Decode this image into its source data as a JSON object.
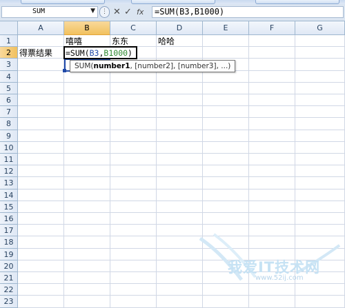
{
  "name_box": {
    "value": "SUM"
  },
  "formula_bar": {
    "cancel_glyph": "✕",
    "enter_glyph": "✓",
    "fx_label": "fx",
    "value": "=SUM(B3,B1000)"
  },
  "columns": [
    "A",
    "B",
    "C",
    "D",
    "E",
    "F",
    "G"
  ],
  "active_column": "B",
  "rows": [
    "1",
    "2",
    "3",
    "4",
    "5",
    "6",
    "7",
    "8",
    "9",
    "10",
    "11",
    "12",
    "13",
    "14",
    "15",
    "16",
    "17",
    "18",
    "19",
    "20",
    "21",
    "22",
    "23"
  ],
  "active_row": "2",
  "cells": {
    "B1": "嘻嘻",
    "C1": "东东",
    "D1": "哈哈",
    "A2": "得票结果"
  },
  "active_cell_formula": {
    "prefix": "=SUM(",
    "ref1": "B3",
    "sep": ",",
    "ref2": "B1000",
    "suffix": ")"
  },
  "tooltip": {
    "fn": "SUM(",
    "arg1": "number1",
    "rest": ", [number2], [number3], ...)"
  },
  "watermark": {
    "text": "我爱IT技术网",
    "url": "www.52ij.com"
  },
  "colors": {
    "header_bg": "#dfe8f5",
    "active_header": "#f1c15e",
    "ref1_color": "#1f49a8",
    "ref2_color": "#2f8a2f"
  }
}
